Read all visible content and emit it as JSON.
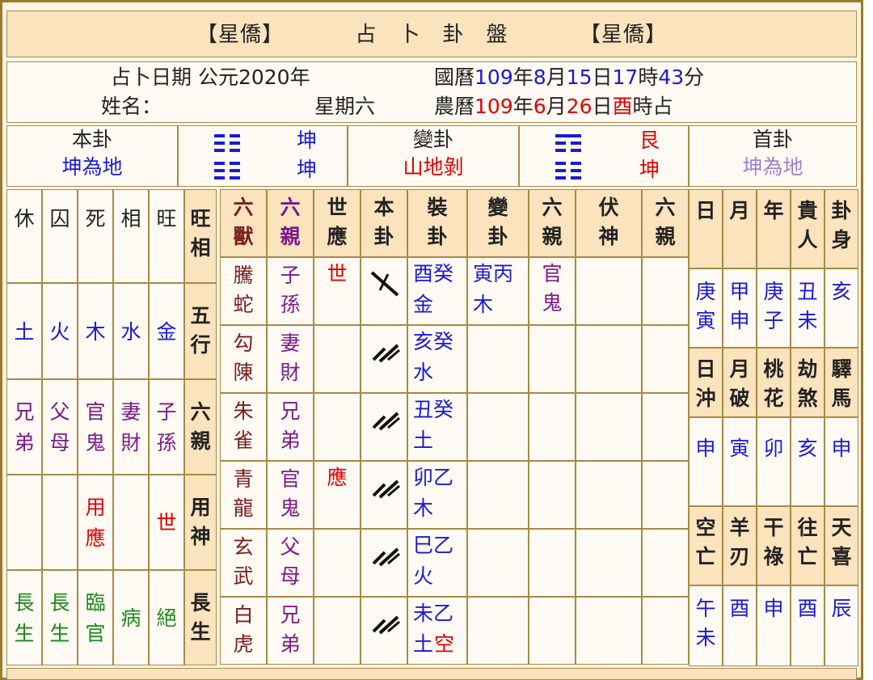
{
  "header": {
    "left_tag": "【星僑】",
    "title": "占　卜　卦　盤",
    "right_tag": "【星僑】"
  },
  "info": {
    "date_label": "占卜日期 公元2020年",
    "name_label": "姓名：",
    "weekday": "星期六",
    "solar": {
      "prefix": "國曆",
      "year": "109",
      "y": "年",
      "month": "8",
      "m": "月",
      "day": "15",
      "d": "日",
      "hour": "17",
      "h": "時",
      "minute": "43",
      "min": "分"
    },
    "lunar": {
      "prefix": "農曆",
      "year": "109",
      "y": "年",
      "month": "6",
      "m": "月",
      "day": "26",
      "d": "日",
      "hour": "酉",
      "h": "時占"
    }
  },
  "hexagrams": {
    "main": {
      "label": "本卦",
      "name": "坤為地",
      "upper": "坤",
      "lower": "坤"
    },
    "changed": {
      "label": "變卦",
      "name": "山地剝",
      "upper": "艮",
      "lower": "坤"
    },
    "head": {
      "label": "首卦",
      "name": "坤為地"
    }
  },
  "season": {
    "headers": [
      "休",
      "囚",
      "死",
      "相",
      "旺"
    ],
    "row_labels": [
      "旺相",
      "五行",
      "六親",
      "用神",
      "長生"
    ],
    "wuxing": [
      "土",
      "火",
      "木",
      "水",
      "金"
    ],
    "liuqin": [
      "兄弟",
      "父母",
      "官鬼",
      "妻財",
      "子孫"
    ],
    "yongshen": [
      "",
      "",
      "用應",
      "",
      "世"
    ],
    "changsheng": [
      "長生",
      "長生",
      "臨官",
      "病",
      "絕"
    ]
  },
  "table": {
    "headers": [
      "六獸",
      "六親",
      "世應",
      "本卦",
      "裝卦",
      "變卦",
      "六親",
      "伏神",
      "六親"
    ],
    "rows": [
      {
        "beast": "騰蛇",
        "kin": "子孫",
        "shiying": "世",
        "line": "yang-moving",
        "zhuang": "酉癸金",
        "zhuang_a": "酉癸",
        "zhuang_b": "金",
        "bian_a": "寅丙",
        "bian_b": "木",
        "bkin": "官鬼"
      },
      {
        "beast": "勾陳",
        "kin": "妻財",
        "shiying": "",
        "line": "yin",
        "zhuang_a": "亥癸",
        "zhuang_b": "水",
        "bian_a": "",
        "bian_b": "",
        "bkin": ""
      },
      {
        "beast": "朱雀",
        "kin": "兄弟",
        "shiying": "",
        "line": "yin",
        "zhuang_a": "丑癸",
        "zhuang_b": "土",
        "bian_a": "",
        "bian_b": "",
        "bkin": ""
      },
      {
        "beast": "青龍",
        "kin": "官鬼",
        "shiying": "應",
        "line": "yin",
        "zhuang_a": "卯乙",
        "zhuang_b": "木",
        "bian_a": "",
        "bian_b": "",
        "bkin": ""
      },
      {
        "beast": "玄武",
        "kin": "父母",
        "shiying": "",
        "line": "yin",
        "zhuang_a": "巳乙",
        "zhuang_b": "火",
        "bian_a": "",
        "bian_b": "",
        "bkin": ""
      },
      {
        "beast": "白虎",
        "kin": "兄弟",
        "shiying": "",
        "line": "yin",
        "zhuang_a": "未乙",
        "zhuang_b": "土",
        "zhuang_c": "空",
        "bian_a": "",
        "bian_b": "",
        "bkin": ""
      }
    ]
  },
  "right": {
    "h1": [
      "日",
      "月",
      "年",
      "貴人",
      "卦身"
    ],
    "v1": [
      "庚寅",
      "甲申",
      "庚子",
      "丑未",
      "亥"
    ],
    "h2": [
      "日沖",
      "月破",
      "桃花",
      "劫煞",
      "驛馬"
    ],
    "v2": [
      "申",
      "寅",
      "卯",
      "亥",
      "申"
    ],
    "h3": [
      "空亡",
      "羊刃",
      "干祿",
      "往亡",
      "天喜"
    ],
    "v3": [
      "午未",
      "酉",
      "申",
      "酉",
      "辰"
    ]
  },
  "colors": {
    "blue": "#1a1ad6",
    "red": "#e00000",
    "purple": "#7a1a8a",
    "brown": "#7a2020",
    "green": "#1a8a1a",
    "header_bg": "#fae3bd",
    "border": "#a68b44"
  }
}
